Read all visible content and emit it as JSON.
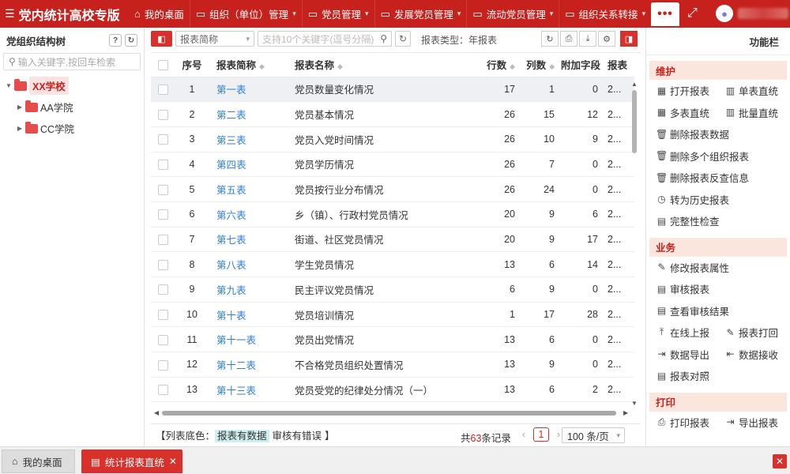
{
  "header": {
    "app_title": "党内统计高校专版",
    "nav": [
      {
        "label": "我的桌面",
        "icon": "home-icon",
        "chevron": false
      },
      {
        "label": "组织（单位）管理",
        "icon": "folder-icon",
        "chevron": true
      },
      {
        "label": "党员管理",
        "icon": "folder-icon",
        "chevron": true
      },
      {
        "label": "发展党员管理",
        "icon": "folder-icon",
        "chevron": true
      },
      {
        "label": "流动党员管理",
        "icon": "folder-icon",
        "chevron": true
      },
      {
        "label": "组织关系转接",
        "icon": "folder-icon",
        "chevron": true
      }
    ],
    "more_label": "•••"
  },
  "left": {
    "title": "党组织结构树",
    "search_placeholder": "输入关键字,按回车检索",
    "tree": [
      {
        "label": "XX学校",
        "level": 0,
        "expanded": true,
        "selected": true
      },
      {
        "label": "AA学院",
        "level": 1,
        "expanded": false
      },
      {
        "label": "CC学院",
        "level": 1,
        "expanded": false
      }
    ]
  },
  "toolbar": {
    "select_value": "报表简称",
    "keyword_placeholder": "支持10个关键字(逗号分隔)",
    "report_type": "报表类型：年报表"
  },
  "table": {
    "headers": [
      "序号",
      "报表简称",
      "报表名称",
      "行数",
      "列数",
      "附加字段",
      "报表"
    ],
    "rows": [
      {
        "no": "1",
        "abbr": "第一表",
        "name": "党员数量变化情况",
        "rows": "17",
        "cols": "1",
        "add": "0",
        "last": "2..."
      },
      {
        "no": "2",
        "abbr": "第二表",
        "name": "党员基本情况",
        "rows": "26",
        "cols": "15",
        "add": "12",
        "last": "2..."
      },
      {
        "no": "3",
        "abbr": "第三表",
        "name": "党员入党时间情况",
        "rows": "26",
        "cols": "10",
        "add": "9",
        "last": "2..."
      },
      {
        "no": "4",
        "abbr": "第四表",
        "name": "党员学历情况",
        "rows": "26",
        "cols": "7",
        "add": "0",
        "last": "2..."
      },
      {
        "no": "5",
        "abbr": "第五表",
        "name": "党员按行业分布情况",
        "rows": "26",
        "cols": "24",
        "add": "0",
        "last": "2..."
      },
      {
        "no": "6",
        "abbr": "第六表",
        "name": "乡（镇）、行政村党员情况",
        "rows": "20",
        "cols": "9",
        "add": "6",
        "last": "2..."
      },
      {
        "no": "7",
        "abbr": "第七表",
        "name": "街道、社区党员情况",
        "rows": "20",
        "cols": "9",
        "add": "17",
        "last": "2..."
      },
      {
        "no": "8",
        "abbr": "第八表",
        "name": "学生党员情况",
        "rows": "13",
        "cols": "6",
        "add": "14",
        "last": "2..."
      },
      {
        "no": "9",
        "abbr": "第九表",
        "name": "民主评议党员情况",
        "rows": "6",
        "cols": "9",
        "add": "0",
        "last": "2..."
      },
      {
        "no": "10",
        "abbr": "第十表",
        "name": "党员培训情况",
        "rows": "1",
        "cols": "17",
        "add": "28",
        "last": "2..."
      },
      {
        "no": "11",
        "abbr": "第十一表",
        "name": "党员出党情况",
        "rows": "13",
        "cols": "6",
        "add": "0",
        "last": "2..."
      },
      {
        "no": "12",
        "abbr": "第十二表",
        "name": "不合格党员组织处置情况",
        "rows": "13",
        "cols": "9",
        "add": "0",
        "last": "2..."
      },
      {
        "no": "13",
        "abbr": "第十三表",
        "name": "党员受党的纪律处分情况（一）",
        "rows": "13",
        "cols": "6",
        "add": "2",
        "last": "2..."
      }
    ]
  },
  "footer": {
    "legend_prefix": "【列表底色：",
    "legend_has_data": "报表有数据",
    "legend_error": "审核有错误",
    "legend_suffix": "】",
    "total_prefix": "共",
    "total_count": "63",
    "total_suffix": "条记录",
    "current_page": "1",
    "page_size": "100 条/页"
  },
  "right": {
    "title": "功能栏",
    "sections": [
      {
        "title": "维护",
        "items": [
          [
            "打开报表",
            "单表直统"
          ],
          [
            "多表直统",
            "批量直统"
          ],
          [
            "删除报表数据"
          ],
          [
            "删除多个组织报表"
          ],
          [
            "删除报表反查信息"
          ],
          [
            "转为历史报表"
          ],
          [
            "完整性检查"
          ]
        ]
      },
      {
        "title": "业务",
        "items": [
          [
            "修改报表属性"
          ],
          [
            "审核报表"
          ],
          [
            "查看审核结果"
          ],
          [
            "在线上报",
            "报表打回"
          ],
          [
            "数据导出",
            "数据接收"
          ],
          [
            "报表对照"
          ]
        ]
      },
      {
        "title": "打印",
        "items": [
          [
            "打印报表",
            "导出报表"
          ]
        ]
      }
    ]
  },
  "bottom": {
    "home_tab": "我的桌面",
    "active_tab": "统计报表直统"
  },
  "colors": {
    "brand_red": "#c7211d",
    "link_blue": "#2f7fd6",
    "section_bg": "#fbe6de",
    "legend_data_bg": "#cfeef0"
  }
}
